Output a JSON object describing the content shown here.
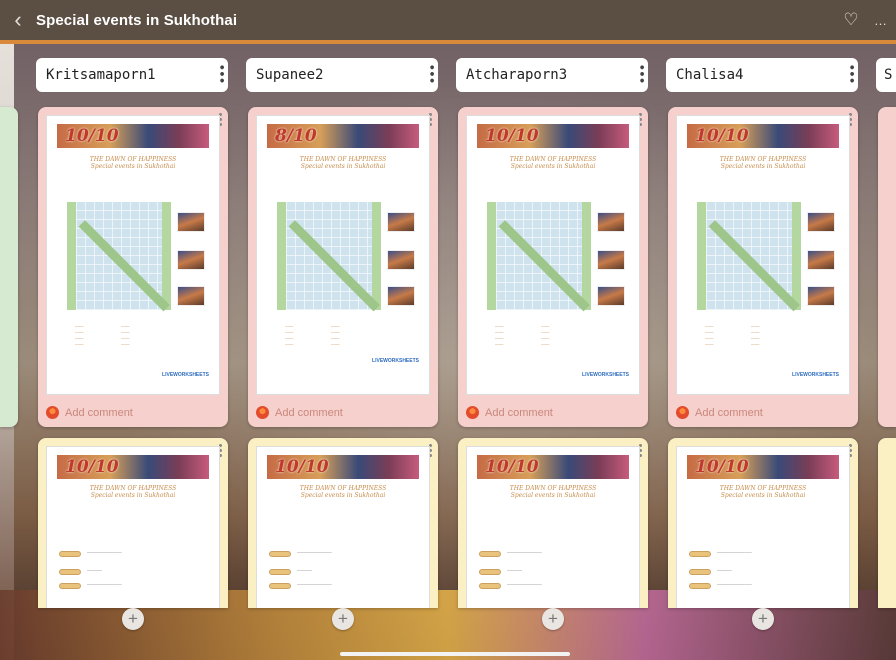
{
  "topbar": {
    "back_icon": "chevron-left-icon",
    "title": "Special events in Sukhothai",
    "heart_icon": "heart-icon",
    "more_icon": "more-icon"
  },
  "columns": [
    {
      "name": "Kritsamaporn1",
      "score1": "10/10",
      "score2": "10/10"
    },
    {
      "name": "Supanee2",
      "score1": "8/10",
      "score2": "10/10"
    },
    {
      "name": "Atcharaporn3",
      "score1": "10/10",
      "score2": "10/10"
    },
    {
      "name": "Chalisa4",
      "score1": "10/10",
      "score2": "10/10"
    },
    {
      "name": "S"
    }
  ],
  "sheet": {
    "title": "THE DAWN OF HAPPINESS",
    "subtitle": "Special events in Sukhothai",
    "brand": "LIVEWORKSHEETS"
  },
  "add_comment": "Add comment",
  "add_post": "+",
  "colors": {
    "accent": "#d9893a",
    "card_pink": "#f6d0cc",
    "card_yellow": "#fbf0c4"
  }
}
